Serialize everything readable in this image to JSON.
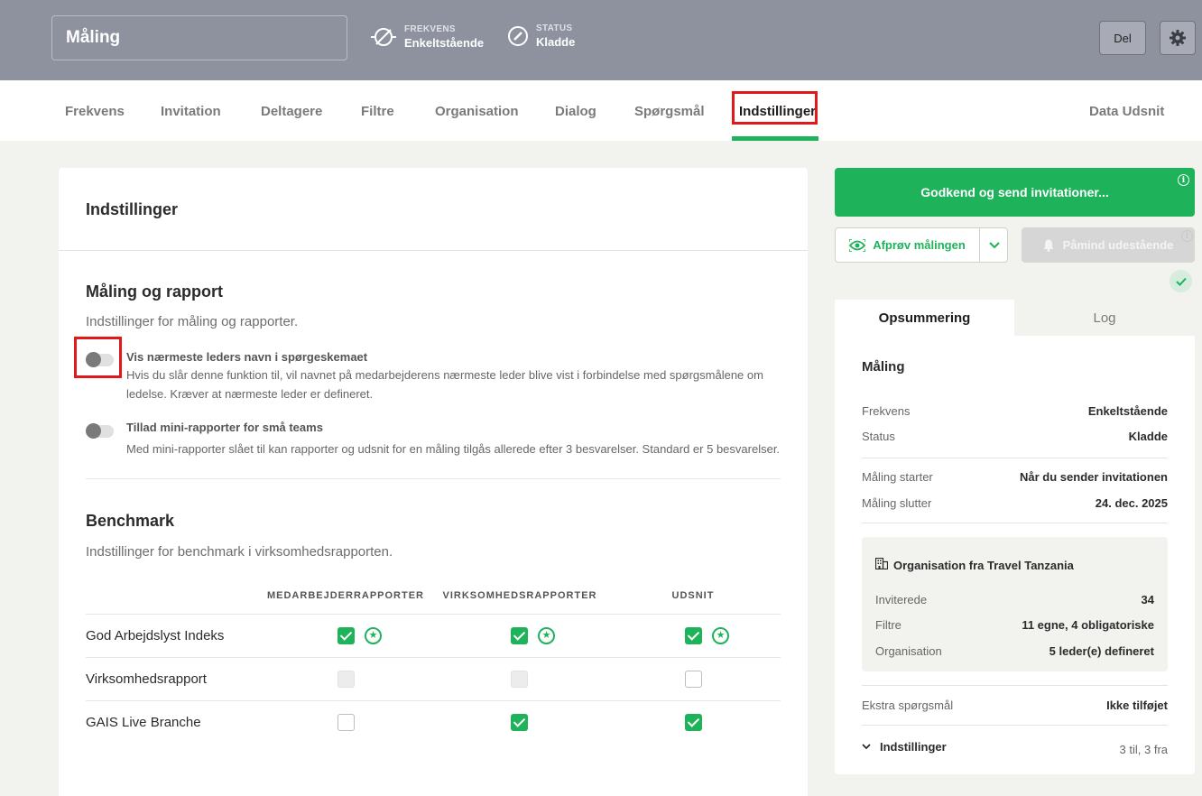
{
  "header": {
    "title": "Måling",
    "frequency": {
      "label": "FREKVENS",
      "value": "Enkeltstående"
    },
    "status": {
      "label": "STATUS",
      "value": "Kladde"
    },
    "share_label": "Del"
  },
  "tabs": [
    {
      "label": "Frekvens"
    },
    {
      "label": "Invitation"
    },
    {
      "label": "Deltagere"
    },
    {
      "label": "Filtre"
    },
    {
      "label": "Organisation"
    },
    {
      "label": "Dialog"
    },
    {
      "label": "Spørgsmål"
    },
    {
      "label": "Indstillinger",
      "active": true
    },
    {
      "label": "Data Udsnit"
    }
  ],
  "settings": {
    "title": "Indstillinger",
    "measure": {
      "title": "Måling og rapport",
      "desc": "Indstillinger for måling og rapporter.",
      "options": [
        {
          "title": "Vis nærmeste leders navn i spørgeskemaet",
          "desc": "Hvis du slår denne funktion til, vil navnet på medarbejderens nærmeste leder blive vist i forbindelse med spørgsmålene om ledelse. Kræver at nærmeste leder er defineret.",
          "enabled": false
        },
        {
          "title": "Tillad mini-rapporter for små teams",
          "desc": "Med mini-rapporter slået til kan rapporter og udsnit for en måling tilgås allerede efter 3 besvarelser. Standard er 5 besvarelser.",
          "enabled": false
        }
      ]
    },
    "benchmark": {
      "title": "Benchmark",
      "desc": "Indstillinger for benchmark i virksomhedsrapporten.",
      "columns": [
        "MEDARBEJDERRAPPORTER",
        "VIRKSOMHEDSRAPPORTER",
        "UDSNIT"
      ],
      "rows": [
        {
          "label": "God Arbejdslyst Indeks",
          "cells": [
            "checked-star",
            "checked-star",
            "checked-star"
          ]
        },
        {
          "label": "Virksomhedsrapport",
          "cells": [
            "disabled",
            "disabled",
            "unchecked"
          ]
        },
        {
          "label": "GAIS Live Branche",
          "cells": [
            "unchecked",
            "checked",
            "checked"
          ]
        }
      ]
    }
  },
  "actions": {
    "approve_label": "Godkend og send invitationer...",
    "try_label": "Afprøv målingen",
    "remind_label": "Påmind udestående"
  },
  "summary": {
    "tab_summary": "Opsummering",
    "tab_log": "Log",
    "title": "Måling",
    "rows1": [
      {
        "k": "Frekvens",
        "v": "Enkeltstående"
      },
      {
        "k": "Status",
        "v": "Kladde"
      }
    ],
    "rows2": [
      {
        "k": "Måling starter",
        "v": "Når du sender invitationen"
      },
      {
        "k": "Måling slutter",
        "v": "24. dec. 2025"
      }
    ],
    "org": {
      "title": "Organisation fra Travel Tanzania",
      "rows": [
        {
          "k": "Inviterede",
          "v": "34"
        },
        {
          "k": "Filtre",
          "v": "11 egne, 4 obligatoriske"
        },
        {
          "k": "Organisation",
          "v": "5 leder(e) defineret"
        }
      ]
    },
    "extra": {
      "k": "Ekstra spørgsmål",
      "v": "Ikke tilføjet"
    },
    "settings": {
      "k": "Indstillinger",
      "v": "3 til, 3 fra"
    }
  },
  "colors": {
    "accent": "#1eb35a",
    "header_bg": "#8e929f",
    "highlight": "#e01a1a"
  }
}
